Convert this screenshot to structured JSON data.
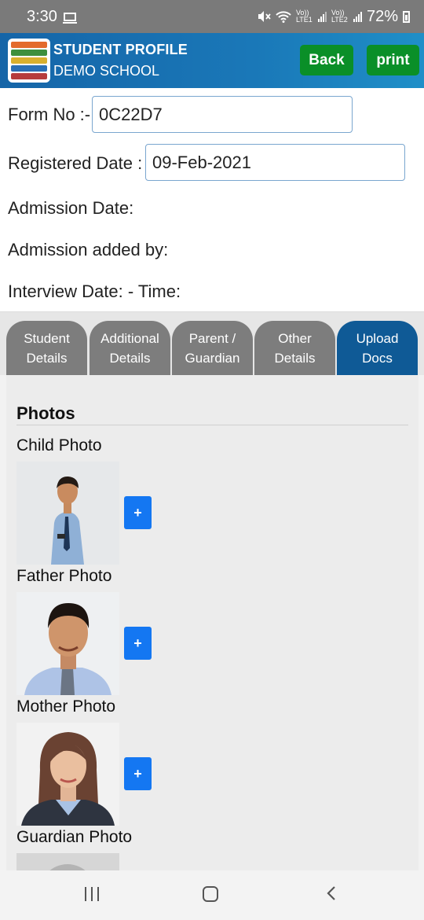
{
  "status_bar": {
    "time": "3:30",
    "network_label_1": "Vo)) LTE1",
    "network_label_2": "Vo)) LTE2",
    "battery_percent": "72%"
  },
  "header": {
    "title": "STUDENT PROFILE",
    "subtitle": "DEMO SCHOOL",
    "back_label": "Back",
    "print_label": "print"
  },
  "form": {
    "form_no_label": "Form No :-",
    "form_no_value": "0C22D7",
    "registered_date_label": "Registered Date :",
    "registered_date_value": "09-Feb-2021",
    "admission_date_label": "Admission Date:",
    "admission_added_by_label": "Admission added by:",
    "interview_label": "Interview Date: - Time:"
  },
  "tabs": [
    {
      "label": "Student\nDetails",
      "active": false
    },
    {
      "label": "Additional\nDetails",
      "active": false
    },
    {
      "label": "Parent /\nGuardian",
      "active": false
    },
    {
      "label": "Other\nDetails",
      "active": false
    },
    {
      "label": "Upload\nDocs",
      "active": true
    }
  ],
  "photos": {
    "section_title": "Photos",
    "items": [
      {
        "label": "Child Photo",
        "add_label": "+"
      },
      {
        "label": "Father Photo",
        "add_label": "+"
      },
      {
        "label": "Mother Photo",
        "add_label": "+"
      },
      {
        "label": "Guardian Photo",
        "add_label": "+"
      }
    ]
  },
  "colors": {
    "header_blue": "#1a78b8",
    "button_green": "#0a8f28",
    "active_tab": "#0f5a96",
    "inactive_tab": "#7d7d7d",
    "add_button": "#1477f2"
  }
}
